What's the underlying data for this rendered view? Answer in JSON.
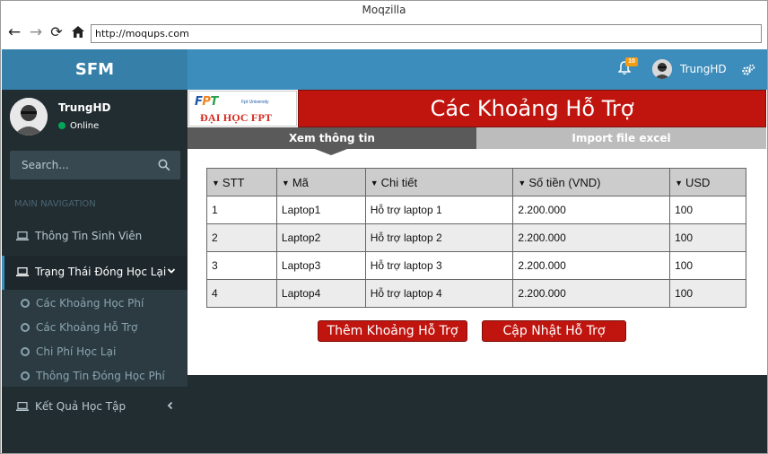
{
  "window": {
    "title": "Moqzilla"
  },
  "browser": {
    "url": "http://moqups.com"
  },
  "app": {
    "brand": "SFM"
  },
  "topnav": {
    "notification_count": "10",
    "user_name": "TrungHD"
  },
  "sidebar": {
    "user_name": "TrungHD",
    "status": "Online",
    "search_placeholder": "Search...",
    "section_header": "MAIN NAVIGATION",
    "items": [
      {
        "label": "Thông Tin Sinh Viên"
      },
      {
        "label": "Trạng Thái Đóng Học Lại",
        "expanded": true
      },
      {
        "label": "Kết Quả Học Tập"
      }
    ],
    "subitems": [
      {
        "label": "Các Khoảng Học Phí"
      },
      {
        "label": "Các Khoảng Hỗ Trợ"
      },
      {
        "label": "Chi Phí Học Lại"
      },
      {
        "label": "Thông Tin Đóng Học Phí"
      }
    ]
  },
  "logo": {
    "letters": [
      "F",
      "P",
      "T"
    ],
    "small_text": "Fpt University",
    "sub_text": "ĐẠI HỌC FPT"
  },
  "page": {
    "title": "Các Khoảng Hỗ Trợ"
  },
  "tabs": [
    {
      "label": "Xem thông tin",
      "active": true
    },
    {
      "label": "Import file excel",
      "active": false
    }
  ],
  "table": {
    "columns": [
      "STT",
      "Mã",
      "Chi tiết",
      "Số tiền (VND)",
      "USD"
    ],
    "rows": [
      [
        "1",
        "Laptop1",
        "Hỗ trợ laptop 1",
        "2.200.000",
        "100"
      ],
      [
        "2",
        "Laptop2",
        "Hỗ trợ laptop 2",
        "2.200.000",
        "100"
      ],
      [
        "3",
        "Laptop3",
        "Hỗ trợ laptop 3",
        "2.200.000",
        "100"
      ],
      [
        "4",
        "Laptop4",
        "Hỗ trợ laptop 4",
        "2.200.000",
        "100"
      ]
    ]
  },
  "actions": {
    "add_label": "Thêm Khoảng Hỗ Trợ",
    "update_label": "Cập Nhật Hỗ Trợ"
  },
  "colors": {
    "header_dark": "#367fa9",
    "header": "#3c8dbc",
    "sidebar": "#222d32",
    "accent_red": "#c0150f",
    "online": "#00a65a",
    "badge": "#f39c12"
  }
}
